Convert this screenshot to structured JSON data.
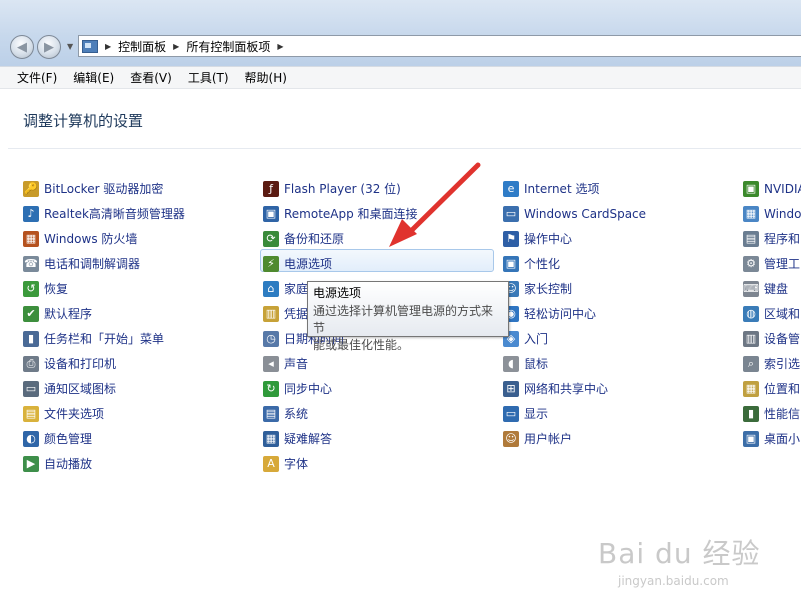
{
  "nav": {
    "back_glyph": "◀",
    "forward_glyph": "▶",
    "dropdown_glyph": "▼"
  },
  "address": {
    "separator": "▶",
    "crumbs": [
      "控制面板",
      "所有控制面板项"
    ]
  },
  "menu": [
    "文件(F)",
    "编辑(E)",
    "查看(V)",
    "工具(T)",
    "帮助(H)"
  ],
  "heading": "调整计算机的设置",
  "columns": [
    [
      {
        "label": "BitLocker 驱动器加密",
        "icon": "bitlocker-icon",
        "color": "#c89b2a",
        "glyph": "🔑"
      },
      {
        "label": "Realtek高清晰音频管理器",
        "icon": "realtek-audio-icon",
        "color": "#2d6fb3",
        "glyph": "♪"
      },
      {
        "label": "Windows 防火墙",
        "icon": "firewall-icon",
        "color": "#b5521f",
        "glyph": "▦"
      },
      {
        "label": "电话和调制解调器",
        "icon": "phone-modem-icon",
        "color": "#7a8a9a",
        "glyph": "☎"
      },
      {
        "label": "恢复",
        "icon": "recovery-icon",
        "color": "#3b9a3b",
        "glyph": "↺"
      },
      {
        "label": "默认程序",
        "icon": "default-programs-icon",
        "color": "#3d8f3d",
        "glyph": "✔"
      },
      {
        "label": "任务栏和「开始」菜单",
        "icon": "taskbar-icon",
        "color": "#4a6a96",
        "glyph": "▮"
      },
      {
        "label": "设备和打印机",
        "icon": "printer-icon",
        "color": "#6f7b89",
        "glyph": "⎙"
      },
      {
        "label": "通知区域图标",
        "icon": "notification-icon",
        "color": "#5a6b7d",
        "glyph": "▭"
      },
      {
        "label": "文件夹选项",
        "icon": "folder-options-icon",
        "color": "#d9b23c",
        "glyph": "▤"
      },
      {
        "label": "颜色管理",
        "icon": "color-management-icon",
        "color": "#2f66a8",
        "glyph": "◐"
      },
      {
        "label": "自动播放",
        "icon": "autoplay-icon",
        "color": "#3e8f4a",
        "glyph": "▶"
      }
    ],
    [
      {
        "label": "Flash Player (32 位)",
        "icon": "flash-player-icon",
        "color": "#5b1b12",
        "glyph": "ƒ"
      },
      {
        "label": "RemoteApp 和桌面连接",
        "icon": "remoteapp-icon",
        "color": "#2f64a6",
        "glyph": "▣"
      },
      {
        "label": "备份和还原",
        "icon": "backup-icon",
        "color": "#3a8b3a",
        "glyph": "⟳"
      },
      {
        "label": "电源选项",
        "icon": "power-options-icon",
        "color": "#4f8a2f",
        "glyph": "⚡"
      },
      {
        "label": "家庭",
        "icon": "homegroup-icon",
        "color": "#2d7cc1",
        "glyph": "⌂"
      },
      {
        "label": "凭据",
        "icon": "credential-icon",
        "color": "#c7a238",
        "glyph": "▥"
      },
      {
        "label": "日期和时间",
        "icon": "datetime-icon",
        "color": "#5779a8",
        "glyph": "◷"
      },
      {
        "label": "声音",
        "icon": "sound-icon",
        "color": "#8a8f96",
        "glyph": "◂"
      },
      {
        "label": "同步中心",
        "icon": "sync-center-icon",
        "color": "#2f9a3a",
        "glyph": "↻"
      },
      {
        "label": "系统",
        "icon": "system-icon",
        "color": "#3b6aa8",
        "glyph": "▤"
      },
      {
        "label": "疑难解答",
        "icon": "troubleshoot-icon",
        "color": "#2f5f9a",
        "glyph": "▦"
      },
      {
        "label": "字体",
        "icon": "fonts-icon",
        "color": "#d7a93a",
        "glyph": "A"
      }
    ],
    [
      {
        "label": "Internet 选项",
        "icon": "internet-options-icon",
        "color": "#2f7cc7",
        "glyph": "e"
      },
      {
        "label": "Windows CardSpace",
        "icon": "cardspace-icon",
        "color": "#3b6fae",
        "glyph": "▭"
      },
      {
        "label": "操作中心",
        "icon": "action-center-icon",
        "color": "#2e5fa6",
        "glyph": "⚑"
      },
      {
        "label": "个性化",
        "icon": "personalization-icon",
        "color": "#3575b8",
        "glyph": "▣"
      },
      {
        "label": "家长控制",
        "icon": "parental-controls-icon",
        "color": "#3a7ab8",
        "glyph": "☺"
      },
      {
        "label": "轻松访问中心",
        "icon": "ease-of-access-icon",
        "color": "#2f75c2",
        "glyph": "◉"
      },
      {
        "label": "入门",
        "icon": "getting-started-icon",
        "color": "#4a8ad0",
        "glyph": "◈"
      },
      {
        "label": "鼠标",
        "icon": "mouse-icon",
        "color": "#8c9198",
        "glyph": "◖"
      },
      {
        "label": "网络和共享中心",
        "icon": "network-icon",
        "color": "#3a5f8f",
        "glyph": "⊞"
      },
      {
        "label": "显示",
        "icon": "display-icon",
        "color": "#2f6bb0",
        "glyph": "▭"
      },
      {
        "label": "用户帐户",
        "icon": "user-accounts-icon",
        "color": "#b07a3a",
        "glyph": "☺"
      }
    ],
    [
      {
        "label": "NVIDIA",
        "icon": "nvidia-icon",
        "color": "#3c8a2c",
        "glyph": "▣"
      },
      {
        "label": "Windo",
        "icon": "windows-icon",
        "color": "#4a86c5",
        "glyph": "▦"
      },
      {
        "label": "程序和",
        "icon": "programs-icon",
        "color": "#6a7d91",
        "glyph": "▤"
      },
      {
        "label": "管理工",
        "icon": "admin-tools-icon",
        "color": "#7b8896",
        "glyph": "⚙"
      },
      {
        "label": "键盘",
        "icon": "keyboard-icon",
        "color": "#7d8590",
        "glyph": "⌨"
      },
      {
        "label": "区域和",
        "icon": "region-icon",
        "color": "#3a7cb8",
        "glyph": "◍"
      },
      {
        "label": "设备管",
        "icon": "device-manager-icon",
        "color": "#6d7784",
        "glyph": "▥"
      },
      {
        "label": "索引选",
        "icon": "indexing-icon",
        "color": "#7a8591",
        "glyph": "⌕"
      },
      {
        "label": "位置和",
        "icon": "location-icon",
        "color": "#c0a040",
        "glyph": "▦"
      },
      {
        "label": "性能信",
        "icon": "performance-icon",
        "color": "#3b6b3b",
        "glyph": "▮"
      },
      {
        "label": "桌面小",
        "icon": "gadgets-icon",
        "color": "#3c6ea8",
        "glyph": "▣"
      }
    ]
  ],
  "tooltip": {
    "title": "电源选项",
    "description_line1": "通过选择计算机管理电源的方式来节",
    "description_line2": "能或最佳化性能。"
  },
  "watermark": {
    "brand": "Bai du 经验",
    "url": "jingyan.baidu.com"
  },
  "colors": {
    "heading": "#1e395b",
    "link": "#1e3287",
    "arrow": "#e0332e"
  }
}
